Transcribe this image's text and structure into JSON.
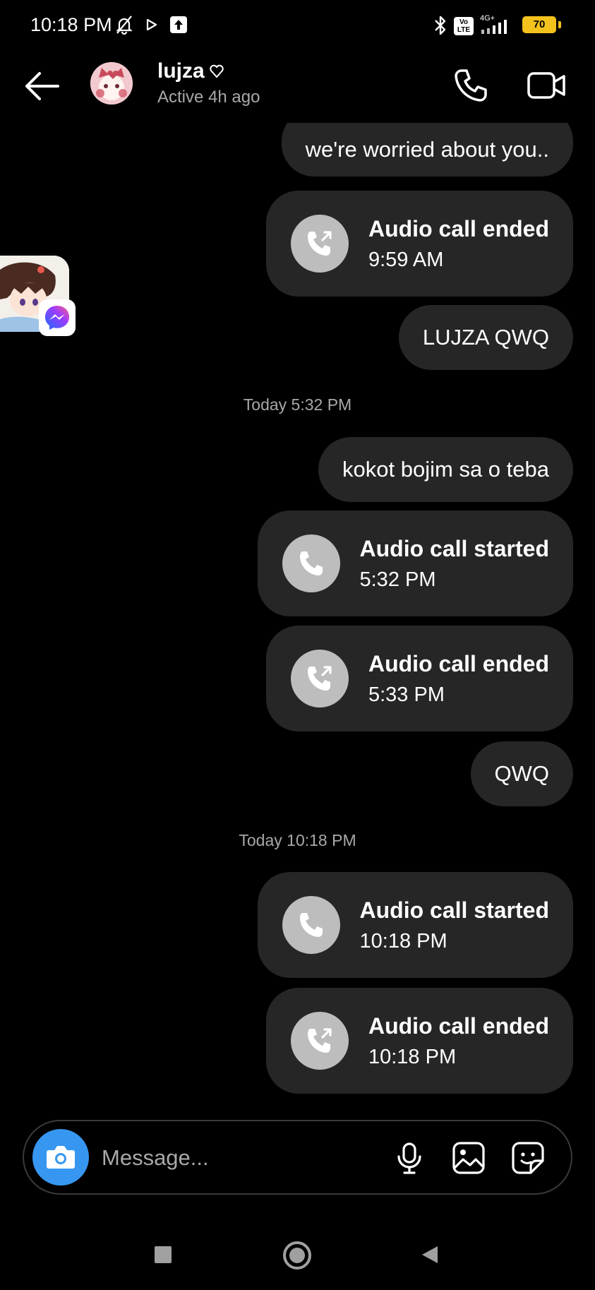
{
  "status_bar": {
    "time": "10:18 PM",
    "network_label": "4G+",
    "volte_label": "Vo LTE",
    "battery_level": "70"
  },
  "header": {
    "contact_name": "lujza",
    "status": "Active 4h ago"
  },
  "messages": [
    {
      "kind": "text",
      "text": "we're worried about you.."
    },
    {
      "kind": "call",
      "title": "Audio call ended",
      "time": "9:59 AM",
      "icon": "call-ended-icon"
    },
    {
      "kind": "text",
      "text": "LUJZA QWQ"
    },
    {
      "kind": "timestamp",
      "text": "Today 5:32 PM"
    },
    {
      "kind": "text",
      "text": "kokot bojim sa o teba"
    },
    {
      "kind": "call",
      "title": "Audio call started",
      "time": "5:32 PM",
      "icon": "phone-icon"
    },
    {
      "kind": "call",
      "title": "Audio call ended",
      "time": "5:33 PM",
      "icon": "call-ended-icon"
    },
    {
      "kind": "text",
      "text": "QWQ"
    },
    {
      "kind": "timestamp",
      "text": "Today 10:18 PM"
    },
    {
      "kind": "call",
      "title": "Audio call started",
      "time": "10:18 PM",
      "icon": "phone-icon"
    },
    {
      "kind": "call",
      "title": "Audio call ended",
      "time": "10:18 PM",
      "icon": "call-ended-icon"
    }
  ],
  "composer": {
    "placeholder": "Message..."
  },
  "colors": {
    "background": "#000000",
    "bubble": "#262626",
    "camera_button": "#3797f0",
    "secondary_text": "#a8a8a8",
    "battery": "#f4c21c"
  }
}
